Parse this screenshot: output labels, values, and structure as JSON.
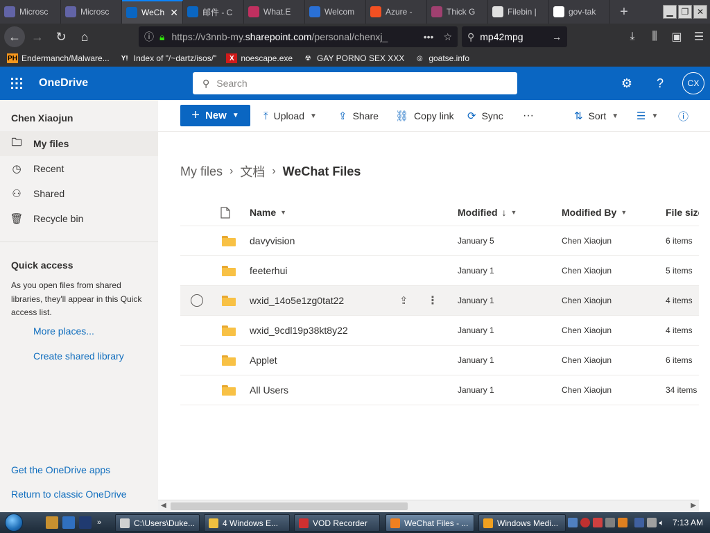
{
  "browser": {
    "tabs": [
      {
        "label": "Microsc",
        "color": "#6264a7"
      },
      {
        "label": "Microsc",
        "color": "#6264a7"
      },
      {
        "label": "WeCh",
        "color": "#0a66c2",
        "active": true
      },
      {
        "label": "邮件 - C",
        "color": "#0a66c2"
      },
      {
        "label": "What.E",
        "color": "#c03060"
      },
      {
        "label": "Welcom",
        "color": "#2a70d6"
      },
      {
        "label": "Azure -",
        "color": "#f25022"
      },
      {
        "label": "Thick G",
        "color": "#a04070"
      },
      {
        "label": "Filebin |",
        "color": "#e0e0e0"
      },
      {
        "label": "gov-tak",
        "color": "#ffffff"
      }
    ],
    "new_tab": "+",
    "url_prefix": "https://v3nnb-my.",
    "url_host": "sharepoint.com",
    "url_rest": "/personal/chenxj_",
    "url_more": "•••",
    "search_value": "mp42mpg",
    "bookmarks": [
      {
        "label": "Endermanch/Malware...",
        "icon": "PH",
        "icon_bg": "#f7971d",
        "icon_fg": "#000"
      },
      {
        "label": "Index of \"/~dartz/isos/\"",
        "icon": "Y!",
        "icon_bg": "#323234",
        "icon_fg": "#fff"
      },
      {
        "label": "noescape.exe",
        "icon": "X",
        "icon_bg": "#d01a1a",
        "icon_fg": "#fff"
      },
      {
        "label": "GAY PORNO SEX XXX",
        "icon": "☢",
        "icon_bg": "#323234",
        "icon_fg": "#fff"
      },
      {
        "label": "goatse.info",
        "icon": "◎",
        "icon_bg": "#323234",
        "icon_fg": "#fff"
      }
    ]
  },
  "onedrive": {
    "title": "OneDrive",
    "search_placeholder": "Search",
    "avatar": "CX",
    "user": "Chen Xiaojun",
    "nav": [
      {
        "label": "My files",
        "icon": "folder-icon",
        "glyph": "🗀",
        "selected": true
      },
      {
        "label": "Recent",
        "icon": "clock-icon",
        "glyph": "◷"
      },
      {
        "label": "Shared",
        "icon": "people-icon",
        "glyph": "⚇"
      },
      {
        "label": "Recycle bin",
        "icon": "trash-icon",
        "glyph": "🗑"
      }
    ],
    "quick_access": {
      "title": "Quick access",
      "description": "As you open files from shared libraries, they'll appear in this Quick access list.",
      "more_places": "More places...",
      "create_library": "Create shared library"
    },
    "get_apps": "Get the OneDrive apps",
    "return_classic": "Return to classic OneDrive",
    "commands": {
      "new": "New",
      "upload": "Upload",
      "share": "Share",
      "copy_link": "Copy link",
      "sync": "Sync",
      "more": "···",
      "sort": "Sort"
    },
    "breadcrumb": [
      "My files",
      "文档",
      "WeChat Files"
    ],
    "columns": {
      "name": "Name",
      "modified": "Modified",
      "modified_by": "Modified By",
      "file_size": "File size"
    },
    "files": [
      {
        "name": "davyvision",
        "modified": "January 5",
        "by": "Chen Xiaojun",
        "size": "6 items"
      },
      {
        "name": "feeterhui",
        "modified": "January 1",
        "by": "Chen Xiaojun",
        "size": "5 items"
      },
      {
        "name": "wxid_14o5e1zg0tat22",
        "modified": "January 1",
        "by": "Chen Xiaojun",
        "size": "4 items",
        "hover": true
      },
      {
        "name": "wxid_9cdl19p38kt8y22",
        "modified": "January 1",
        "by": "Chen Xiaojun",
        "size": "4 items"
      },
      {
        "name": "Applet",
        "modified": "January 1",
        "by": "Chen Xiaojun",
        "size": "6 items"
      },
      {
        "name": "All Users",
        "modified": "January 1",
        "by": "Chen Xiaojun",
        "size": "34 items"
      }
    ]
  },
  "taskbar": {
    "tasks": [
      {
        "label": "C:\\Users\\Duke...",
        "color": "#d0d0d0"
      },
      {
        "label": "4 Windows E...",
        "color": "#f0c040"
      },
      {
        "label": "VOD Recorder",
        "color": "#d03030"
      },
      {
        "label": "WeChat Files - ...",
        "color": "#f08020",
        "active": true
      },
      {
        "label": "Windows Medi...",
        "color": "#f0a020"
      }
    ],
    "clock": "7:13 AM"
  }
}
